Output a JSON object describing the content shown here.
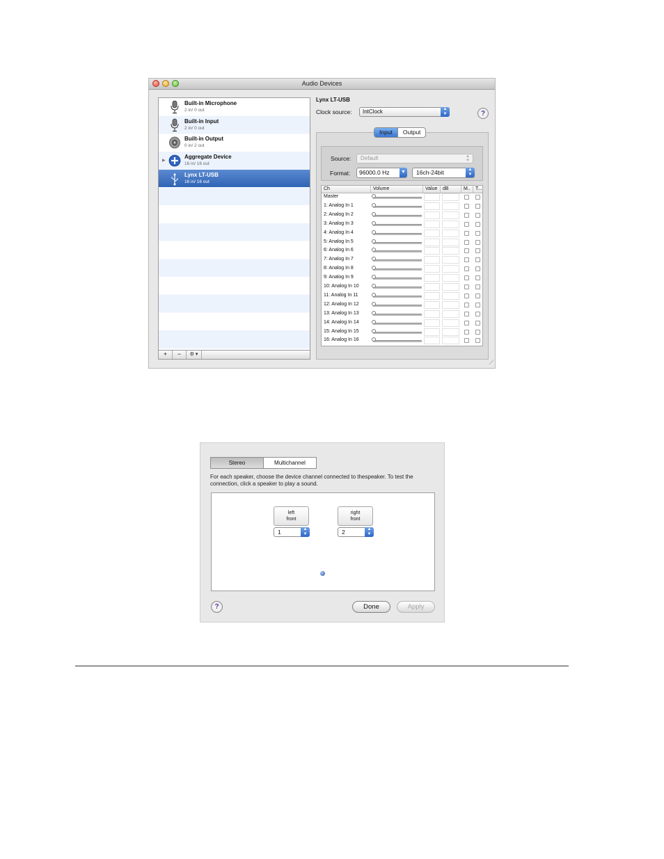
{
  "window": {
    "title": "Audio Devices",
    "devices": [
      {
        "name": "Built-in Microphone",
        "io": "2 in/ 0 out",
        "icon": "microphone-icon",
        "selected": false
      },
      {
        "name": "Built-in Input",
        "io": "2 in/ 0 out",
        "icon": "microphone-icon",
        "selected": false
      },
      {
        "name": "Built-in Output",
        "io": "0 in/ 2 out",
        "icon": "speaker-icon",
        "selected": false
      },
      {
        "name": "Aggregate Device",
        "io": "16 in/ 16 out",
        "icon": "plus-circle-icon",
        "selected": false
      },
      {
        "name": "Lynx LT-USB",
        "io": "16 in/ 16 out",
        "icon": "usb-icon",
        "selected": true
      }
    ],
    "list_toolbar": {
      "add": "+",
      "remove": "−",
      "action": "⚙ ▾"
    },
    "device_title": "Lynx LT-USB",
    "clock_label": "Clock source:",
    "clock_value": "IntClock",
    "help": "?",
    "tabs": [
      "Input",
      "Output"
    ],
    "active_tab": "Input",
    "source_label": "Source:",
    "source_value": "Default",
    "format_label": "Format:",
    "rate_value": "96000.0 Hz",
    "bits_value": "16ch-24bit",
    "columns": [
      "Ch",
      "Volume",
      "Value",
      "dB",
      "M..",
      "T..."
    ],
    "channels": [
      "Master",
      "1: Analog In 1",
      "2: Analog In 2",
      "3: Analog In 3",
      "4: Analog In 4",
      "5: Analog In 5",
      "6: Analog In 6",
      "7: Analog In 7",
      "8: Analog In 8",
      "9: Analog In 9",
      "10: Analog In 10",
      "11: Analog In 11",
      "12: Analog In 12",
      "13: Analog In 13",
      "14: Analog In 14",
      "15: Analog In 15",
      "16: Analog In 16"
    ]
  },
  "dialog": {
    "segments": [
      "Stereo",
      "Multichannel"
    ],
    "instructions": "For each speaker, choose the device channel connected to thespeaker. To test the connection, click a speaker to play a sound.",
    "left_speaker": {
      "line1": "left",
      "line2": "front",
      "channel": "1"
    },
    "right_speaker": {
      "line1": "right",
      "line2": "front",
      "channel": "2"
    },
    "help": "?",
    "done": "Done",
    "apply": "Apply"
  }
}
